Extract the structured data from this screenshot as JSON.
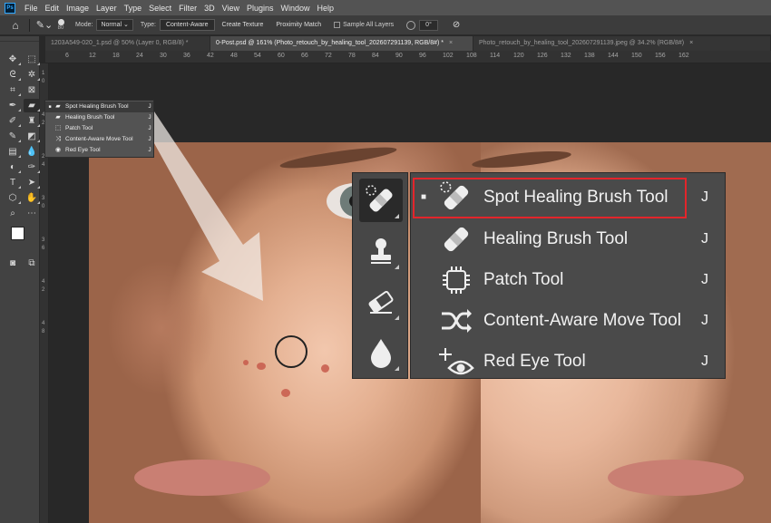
{
  "menubar": {
    "logo": "Ps",
    "items": [
      "File",
      "Edit",
      "Image",
      "Layer",
      "Type",
      "Select",
      "Filter",
      "3D",
      "View",
      "Plugins",
      "Window",
      "Help"
    ]
  },
  "options": {
    "brush_size": "80",
    "mode_label": "Mode:",
    "mode_value": "Normal",
    "type_label": "Type:",
    "type_options": [
      "Content-Aware",
      "Create Texture",
      "Proximity Match"
    ],
    "sample_all_layers": "Sample All Layers",
    "angle_value": "0°"
  },
  "tabs": [
    {
      "label": "1203A549-020_1.psd @ 50% (Layer 0, RGB/8) *",
      "active": false
    },
    {
      "label": "0-Post.psd @ 161% (Photo_retouch_by_healing_tool_202607291139, RGB/8#) *",
      "active": true
    },
    {
      "label": "Photo_retouch_by_healing_tool_202607291139.jpeg @ 34.2% (RGB/8#)",
      "active": false
    }
  ],
  "ruler_top": [
    "6",
    "12",
    "18",
    "24",
    "30",
    "36",
    "42",
    "48",
    "54",
    "60",
    "66",
    "72",
    "78",
    "84",
    "90",
    "96",
    "102",
    "108",
    "114",
    "120",
    "126",
    "132",
    "138",
    "144",
    "150",
    "156",
    "162"
  ],
  "ruler_left": [
    "1",
    "0",
    "4",
    "2",
    "2",
    "4",
    "3",
    "0",
    "3",
    "6",
    "4",
    "2",
    "4",
    "8"
  ],
  "small_flyout": [
    {
      "label": "Spot Healing Brush Tool",
      "key": "J",
      "active": true
    },
    {
      "label": "Healing Brush Tool",
      "key": "J",
      "active": false
    },
    {
      "label": "Patch Tool",
      "key": "J",
      "active": false
    },
    {
      "label": "Content-Aware Move Tool",
      "key": "J",
      "active": false
    },
    {
      "label": "Red Eye Tool",
      "key": "J",
      "active": false
    }
  ],
  "big_flyout": [
    {
      "label": "Spot Healing Brush Tool",
      "key": "J",
      "active": true,
      "icon": "spot-healing-brush-icon"
    },
    {
      "label": "Healing Brush Tool",
      "key": "J",
      "active": false,
      "icon": "healing-brush-icon"
    },
    {
      "label": "Patch Tool",
      "key": "J",
      "active": false,
      "icon": "patch-icon"
    },
    {
      "label": "Content-Aware Move Tool",
      "key": "J",
      "active": false,
      "icon": "content-aware-move-icon"
    },
    {
      "label": "Red Eye Tool",
      "key": "J",
      "active": false,
      "icon": "red-eye-icon"
    }
  ],
  "colors": {
    "highlight": "#e3252b",
    "panel": "#4a4a4a",
    "app_bg": "#282828"
  }
}
